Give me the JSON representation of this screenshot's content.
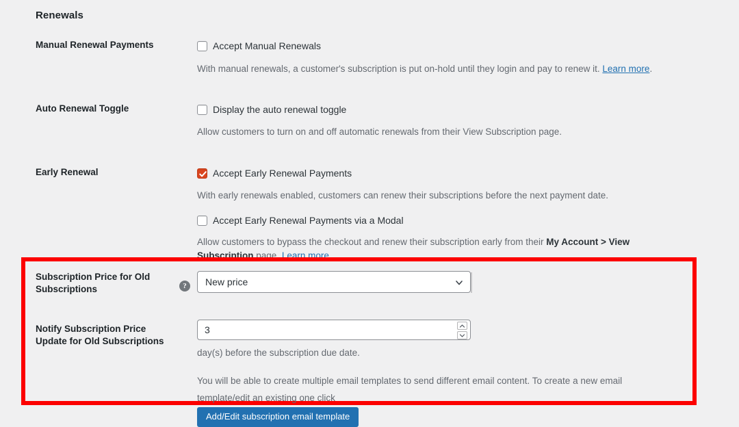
{
  "section": {
    "title": "Renewals"
  },
  "rows": {
    "manual": {
      "label": "Manual Renewal Payments",
      "checkbox_label": "Accept Manual Renewals",
      "checked": false,
      "description_before": "With manual renewals, a customer's subscription is put on-hold until they login and pay to renew it. ",
      "link_text": "Learn more",
      "description_after": "."
    },
    "auto_toggle": {
      "label": "Auto Renewal Toggle",
      "checkbox_label": "Display the auto renewal toggle",
      "checked": false,
      "description": "Allow customers to turn on and off automatic renewals from their View Subscription page."
    },
    "early_renewal": {
      "label": "Early Renewal",
      "checkbox_label": "Accept Early Renewal Payments",
      "checked": true,
      "description": "With early renewals enabled, customers can renew their subscriptions before the next payment date.",
      "modal_checkbox_label": "Accept Early Renewal Payments via a Modal",
      "modal_checked": false,
      "modal_desc_1": "Allow customers to bypass the checkout and renew their subscription early from their ",
      "modal_desc_bold": "My Account > View Subscription",
      "modal_desc_2": " page. ",
      "modal_link_text": "Learn more.",
      "modal_desc_3": ""
    },
    "price_old_subs": {
      "label_line1": "Subscription Price for Old",
      "label_line2": "Subscriptions",
      "help_icon": "help-icon",
      "select_value": "New price",
      "select_options": [
        "New price"
      ]
    },
    "notify_price_update": {
      "label_line1": "Notify Subscription Price",
      "label_line2": "Update for Old Subscriptions",
      "number_value": "3",
      "unit_description": "day(s) before the subscription due date.",
      "email_text_1": "You will be able to create multiple email templates to send different email content. To create a new email",
      "email_text_2": "template/edit an existing one click",
      "button_label": "Add/Edit subscription email template"
    }
  },
  "colors": {
    "page_background": "#f0f0f1",
    "highlight_border": "#fc0000",
    "checkbox_checked": "#d9451f",
    "link": "#2271b1",
    "button": "#2271b1"
  }
}
